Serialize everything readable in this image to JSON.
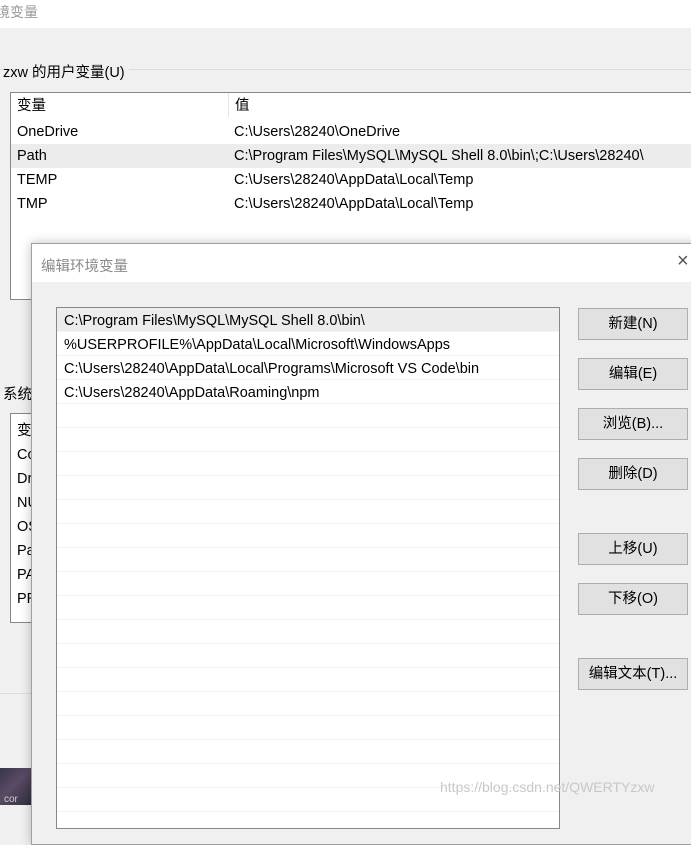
{
  "window": {
    "title": "境变量"
  },
  "user_vars": {
    "group_label": "zxw 的用户变量(U)",
    "headers": [
      "变量",
      "值"
    ],
    "rows": [
      {
        "name": "OneDrive",
        "value": "C:\\Users\\28240\\OneDrive"
      },
      {
        "name": "Path",
        "value": "C:\\Program Files\\MySQL\\MySQL Shell 8.0\\bin\\;C:\\Users\\28240\\"
      },
      {
        "name": "TEMP",
        "value": "C:\\Users\\28240\\AppData\\Local\\Temp"
      },
      {
        "name": "TMP",
        "value": "C:\\Users\\28240\\AppData\\Local\\Temp"
      }
    ],
    "selected_index": 1
  },
  "system_vars": {
    "group_label": "系统",
    "items": [
      "变",
      "Co",
      "Dr",
      "NU",
      "OS",
      "Pa",
      "PA",
      "PR"
    ]
  },
  "dialog": {
    "title": "编辑环境变量",
    "close_glyph": "×",
    "entries": [
      "C:\\Program Files\\MySQL\\MySQL Shell 8.0\\bin\\",
      "%USERPROFILE%\\AppData\\Local\\Microsoft\\WindowsApps",
      "C:\\Users\\28240\\AppData\\Local\\Programs\\Microsoft VS Code\\bin",
      "C:\\Users\\28240\\AppData\\Roaming\\npm"
    ],
    "selected_index": 0,
    "buttons": {
      "new": "新建(N)",
      "edit": "编辑(E)",
      "browse": "浏览(B)...",
      "delete": "删除(D)",
      "move_up": "上移(U)",
      "move_down": "下移(O)",
      "edit_text": "编辑文本(T)..."
    }
  },
  "thumb_text": "cor",
  "watermark": "https://blog.csdn.net/QWERTYzxw"
}
